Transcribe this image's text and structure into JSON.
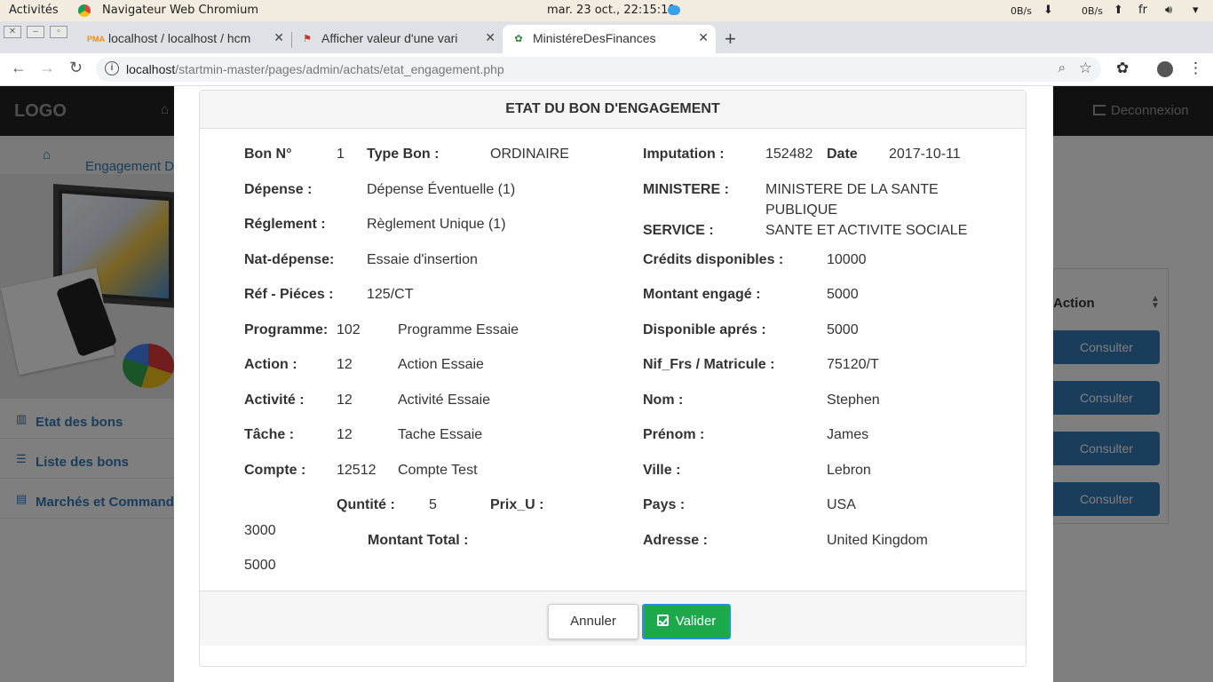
{
  "system": {
    "activities": "Activités",
    "app_name": "Navigateur Web Chromium",
    "clock": "mar. 23 oct., 22:15:10",
    "net_down": "0B/s",
    "net_up": "0B/s",
    "lang": "fr"
  },
  "browser": {
    "tabs": [
      {
        "title": "localhost / localhost / hcm",
        "favicon": "phpmyadmin-icon"
      },
      {
        "title": "Afficher valeur d'une vari",
        "favicon": "stackoverflow-icon"
      },
      {
        "title": "MinistéreDesFinances",
        "favicon": "emblem-icon"
      }
    ],
    "url_host": "localhost",
    "url_path": "/startmin-master/pages/admin/achats/etat_engagement.php"
  },
  "app": {
    "logo": "LOGO",
    "logout": "Deconnexion",
    "breadcrumb": "Engagement Dépe",
    "menu": [
      {
        "label": "Etat des bons",
        "icon": "bar-chart-icon"
      },
      {
        "label": "Liste des bons",
        "icon": "list-icon"
      },
      {
        "label": "Marchés et Commandes",
        "icon": "table-icon"
      }
    ],
    "table_header_action": "Action",
    "consult_label": "Consulter"
  },
  "modal": {
    "title": "ETAT DU BON D'ENGAGEMENT",
    "left": {
      "bon_label": "Bon N°",
      "bon_value": "1",
      "type_label": "Type Bon :",
      "type_value": "ORDINAIRE",
      "depense_label": "Dépense :",
      "depense_value": "Dépense Éventuelle (1)",
      "reglement_label": "Réglement :",
      "reglement_value": "Règlement Unique (1)",
      "natdep_label": "Nat-dépense:",
      "natdep_value": "Essaie d'insertion",
      "ref_label": "Réf - Piéces :",
      "ref_value": "125/CT",
      "programme_label": "Programme:",
      "programme_code": "102",
      "programme_value": "Programme Essaie",
      "action_label": "Action :",
      "action_code": "12",
      "action_value": "Action Essaie",
      "activite_label": "Activité :",
      "activite_code": "12",
      "activite_value": "Activité Essaie",
      "tache_label": "Tâche :",
      "tache_code": "12",
      "tache_value": "Tache Essaie",
      "compte_label": "Compte :",
      "compte_code": "12512",
      "compte_value": "Compte Test",
      "quantite_label": "Quntité :",
      "quantite_value": "5",
      "prix_label": "Prix_U :",
      "prix_value": "3000",
      "montant_total_label": "Montant Total :",
      "montant_total_value": "5000"
    },
    "right": {
      "imputation_label": "Imputation :",
      "imputation_value": "152482",
      "date_label": "Date",
      "date_value": "2017-10-11",
      "ministere_label": "MINISTERE :",
      "ministere_value": "MINISTERE DE LA SANTE PUBLIQUE",
      "service_label": "SERVICE :",
      "service_value": "SANTE ET ACTIVITE SOCIALE",
      "credits_label": "Crédits disponibles :",
      "credits_value": "10000",
      "montant_engage_label": "Montant engagé :",
      "montant_engage_value": "5000",
      "disponible_label": "Disponible aprés :",
      "disponible_value": "5000",
      "nif_label": "Nif_Frs / Matricule :",
      "nif_value": "75120/T",
      "nom_label": "Nom :",
      "nom_value": "Stephen",
      "prenom_label": "Prénom :",
      "prenom_value": "James",
      "ville_label": "Ville :",
      "ville_value": "Lebron",
      "pays_label": "Pays :",
      "pays_value": "USA",
      "adresse_label": "Adresse :",
      "adresse_value": "United Kingdom"
    },
    "buttons": {
      "cancel": "Annuler",
      "validate": "Valider"
    }
  }
}
